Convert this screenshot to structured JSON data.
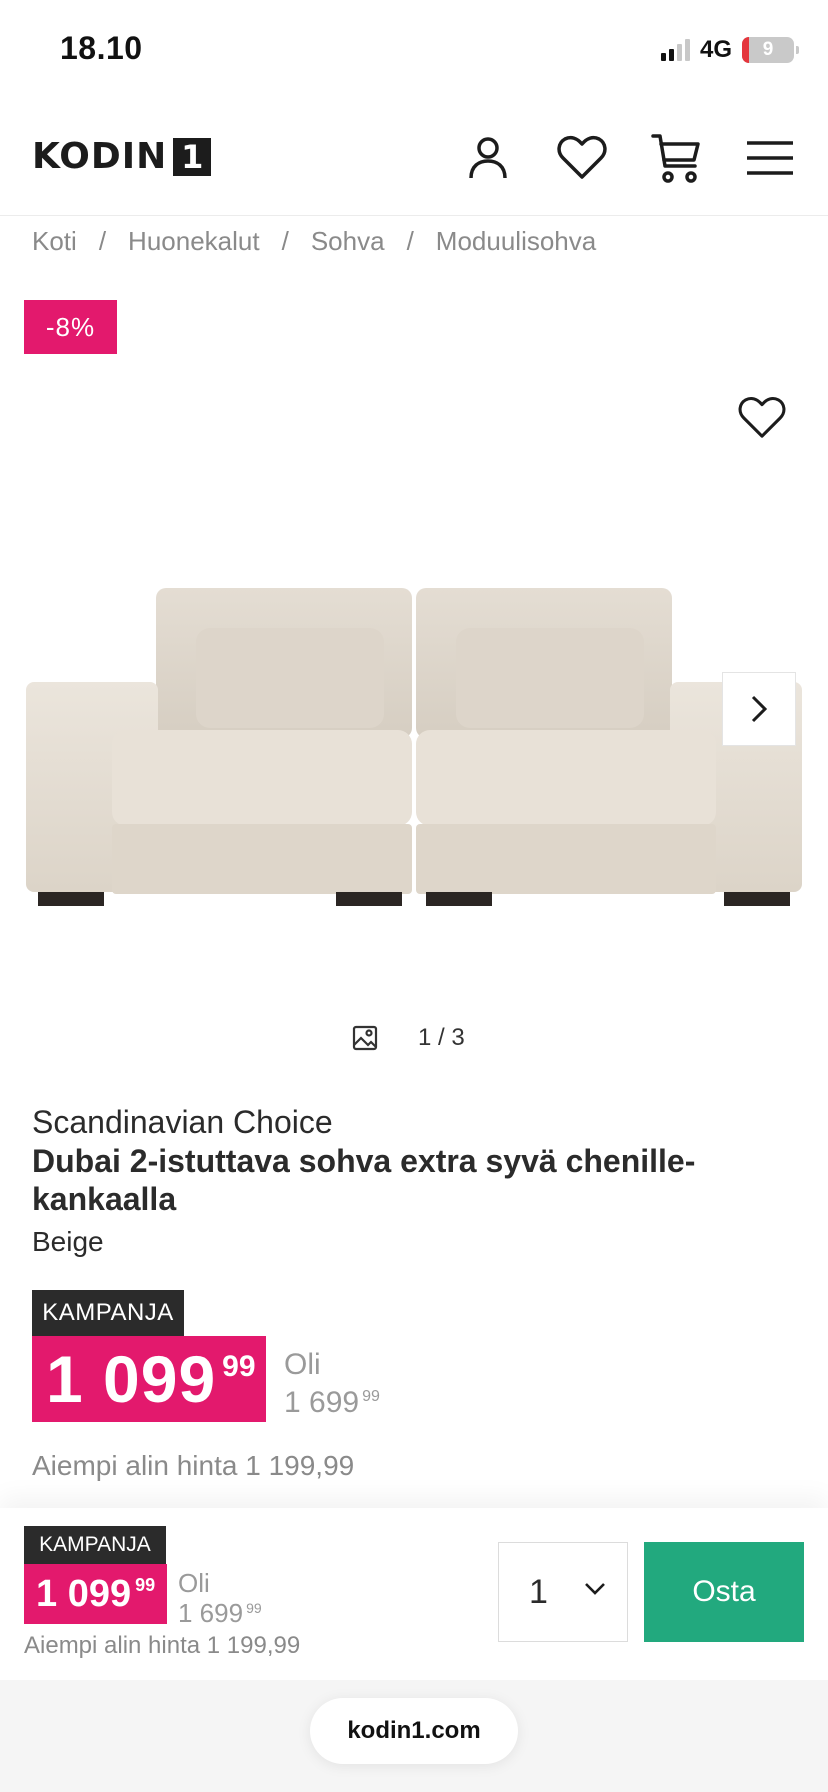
{
  "status_bar": {
    "time": "18.10",
    "network": "4G",
    "battery": "9"
  },
  "header": {
    "logo_text": "KODIN",
    "logo_number": "1",
    "icons": [
      "account-icon",
      "heart-icon",
      "cart-icon",
      "menu-icon"
    ]
  },
  "breadcrumb": [
    "Koti",
    "Huonekalut",
    "Sohva",
    "Moduulisohva"
  ],
  "gallery": {
    "discount": "-8%",
    "counter": "1 / 3",
    "accent_color": "#e3196d"
  },
  "product": {
    "brand": "Scandinavian Choice",
    "title": "Dubai 2-istuttava sohva extra syvä chenille-kankaalla",
    "variant": "Beige",
    "campaign_label": "KAMPANJA",
    "price_main": "1 099",
    "price_cents": "99",
    "old_label": "Oli",
    "old_price_main": "1 699",
    "old_price_cents": "99",
    "previous_lowest": "Aiempi alin hinta 1 199,99"
  },
  "sticky_bar": {
    "campaign_label": "KAMPANJA",
    "price_main": "1 099",
    "price_cents": "99",
    "old_label": "Oli",
    "old_price_main": "1 699",
    "old_price_cents": "99",
    "previous_lowest": "Aiempi alin hinta 1 199,99",
    "quantity": "1",
    "buy_label": "Osta",
    "buy_color": "#22a97e"
  },
  "browser": {
    "url": "kodin1.com"
  }
}
